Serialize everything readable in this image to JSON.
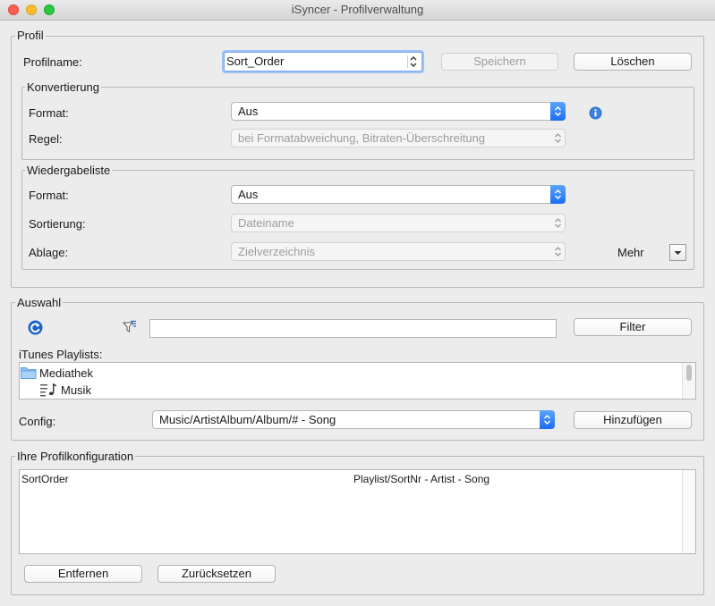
{
  "window": {
    "title": "iSyncer - Profilverwaltung"
  },
  "profil": {
    "title": "Profil",
    "name_label": "Profilname:",
    "name_value": "Sort_Order",
    "save_label": "Speichern",
    "delete_label": "Löschen"
  },
  "konvertierung": {
    "title": "Konvertierung",
    "format_label": "Format:",
    "format_value": "Aus",
    "regel_label": "Regel:",
    "regel_value": "bei Formatabweichung, Bitraten-Überschreitung",
    "info_icon": "info-icon"
  },
  "wiedergabeliste": {
    "title": "Wiedergabeliste",
    "format_label": "Format:",
    "format_value": "Aus",
    "sortierung_label": "Sortierung:",
    "sortierung_value": "Dateiname",
    "ablage_label": "Ablage:",
    "ablage_value": "Zielverzeichnis",
    "mehr_label": "Mehr"
  },
  "auswahl": {
    "title": "Auswahl",
    "filter_value": "",
    "filter_label": "Filter",
    "playlists_label": "iTunes Playlists:",
    "playlists": [
      {
        "label": "Mediathek",
        "icon": "folder-icon"
      },
      {
        "label": "Musik",
        "icon": "music-list-icon"
      }
    ],
    "config_label": "Config:",
    "config_value": "Music/ArtistAlbum/Album/# - Song",
    "add_label": "Hinzufügen"
  },
  "profilkonfiguration": {
    "title": "Ihre Profilkonfiguration",
    "rows": [
      {
        "name": "SortOrder",
        "pattern": "Playlist/SortNr - Artist - Song"
      }
    ],
    "remove_label": "Entfernen",
    "reset_label": "Zurücksetzen"
  }
}
